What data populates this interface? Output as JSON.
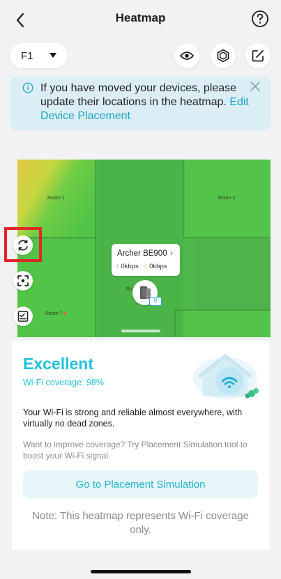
{
  "header": {
    "title": "Heatmap"
  },
  "toolbar": {
    "floor": "F1"
  },
  "banner": {
    "message": "If you have moved your devices, please update their locations in the heatmap.",
    "link": "Edit Device Placement"
  },
  "heatmap": {
    "rooms": [
      "Room 1",
      "Room 2",
      "Ro",
      "Room 7"
    ],
    "device": {
      "name": "Archer BE900",
      "down": "0kbps",
      "up": "0kbps",
      "clients": "0"
    }
  },
  "result": {
    "status": "Excellent",
    "coverage": "Wi-Fi coverage: 98%",
    "description": "Your Wi-Fi is strong and reliable almost everywhere, with virtually no dead zones.",
    "hint": "Want to improve coverage? Try Placement Simulation tool to boost your Wi-Fi signal.",
    "button": "Go to Placement Simulation",
    "note": "Note: This heatmap represents Wi-Fi coverage only."
  },
  "colors": {
    "accent": "#22c1dc",
    "heat_strong": "#4db84a",
    "heat_medium": "#d8d645",
    "highlight": "#e02727"
  }
}
